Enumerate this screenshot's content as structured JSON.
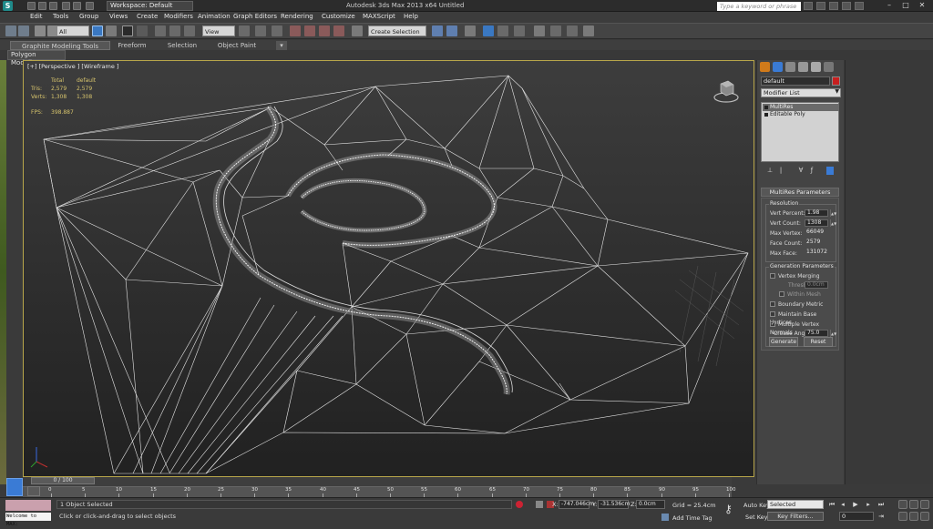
{
  "titlebar": {
    "workspace_label": "Workspace: Default",
    "app_title": "Autodesk 3ds Max  2013 x64     Untitled",
    "search_placeholder": "Type a keyword or phrase"
  },
  "menu": [
    "Edit",
    "Tools",
    "Group",
    "Views",
    "Create",
    "Modifiers",
    "Animation",
    "Graph Editors",
    "Rendering",
    "Customize",
    "MAXScript",
    "Help"
  ],
  "toolbar": {
    "selection_filter": "All",
    "ref_coord": "View",
    "named_selection": "Create Selection Se"
  },
  "ribbon": {
    "tabs": [
      "Graphite Modeling Tools",
      "Freeform",
      "Selection",
      "Object Paint"
    ],
    "panel_label": "Polygon Modeling"
  },
  "viewport": {
    "label": "[+] [Perspective ] [Wireframe ]",
    "stats": {
      "headers": [
        "Total",
        "default"
      ],
      "tris_label": "Tris:",
      "tris_total": "2,579",
      "tris_default": "2,579",
      "verts_label": "Verts:",
      "verts_total": "1,308",
      "verts_default": "1,308",
      "fps_label": "FPS:",
      "fps_value": "398.887"
    }
  },
  "command_panel": {
    "object_name": "default",
    "object_color": "#c81f1f",
    "modifier_list": "Modifier List",
    "stack": [
      "MultiRes",
      "Editable Poly"
    ],
    "rollout_title": "MultiRes Parameters",
    "resolution": {
      "title": "Resolution",
      "vert_percent_label": "Vert Percent:",
      "vert_percent": "1.98",
      "vert_count_label": "Vert Count:",
      "vert_count": "1308",
      "max_vertex_label": "Max Vertex:",
      "max_vertex": "66049",
      "face_count_label": "Face Count:",
      "face_count": "2579",
      "max_face_label": "Max Face:",
      "max_face": "131072"
    },
    "generation": {
      "title": "Generation Parameters",
      "vertex_merging": "Vertex Merging",
      "threshold_label": "Threshold:",
      "threshold": "0.0cm",
      "within_mesh": "Within Mesh",
      "boundary_metric": "Boundary Metric",
      "maintain_base": "Maintain Base Vertices",
      "multiple_normals": "Multiple Vertex Normals",
      "crease_label": "Crease Angle:",
      "crease": "75.0",
      "generate": "Generate",
      "reset": "Reset"
    }
  },
  "timeline": {
    "slider": "0 / 100",
    "ticks": [
      "0",
      "5",
      "10",
      "15",
      "20",
      "25",
      "30",
      "35",
      "40",
      "45",
      "50",
      "55",
      "60",
      "65",
      "70",
      "75",
      "80",
      "85",
      "90",
      "95",
      "100"
    ]
  },
  "status": {
    "selection": "1 Object Selected",
    "prompt": "Click or click-and-drag to select objects",
    "welcome": "Welcome to MAX:",
    "x_label": "X:",
    "x_value": "-747.046cm",
    "y_label": "Y:",
    "y_value": "-31.536cm",
    "z_label": "Z:",
    "z_value": "0.0cm",
    "grid": "Grid = 25.4cm",
    "add_time_tag": "Add Time Tag",
    "auto_key": "Auto Key",
    "set_key": "Set Key",
    "key_mode": "Selected",
    "key_filters": "Key Filters...",
    "frame": "0"
  }
}
